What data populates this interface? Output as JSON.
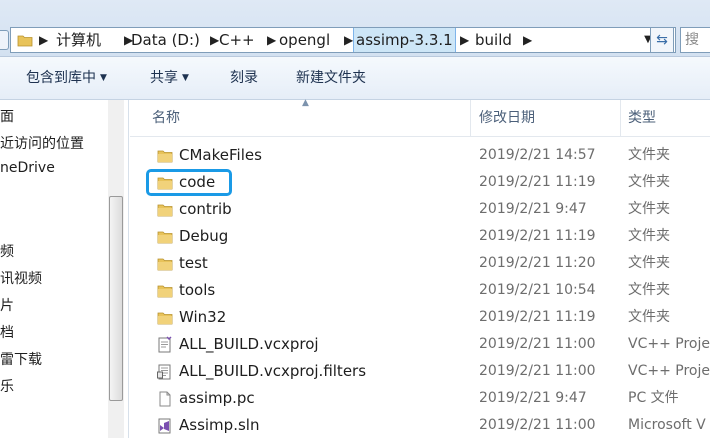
{
  "address_bar": {
    "segments": [
      "计算机",
      "Data (D:)",
      "C++",
      "opengl",
      "assimp-3.3.1",
      "build"
    ],
    "search_placeholder": "搜"
  },
  "toolbar": {
    "include_in_library": "包含到库中",
    "share": "共享",
    "burn": "刻录",
    "new_folder": "新建文件夹"
  },
  "nav_pane": {
    "items": [
      "面",
      "近访问的位置",
      "neDrive",
      "频",
      "讯视频",
      "片",
      "档",
      "雷下载",
      "乐"
    ]
  },
  "columns": {
    "name": "名称",
    "date": "修改日期",
    "type": "类型"
  },
  "files": [
    {
      "icon": "folder-icon",
      "name": "CMakeFiles",
      "date": "2019/2/21 14:57",
      "type": "文件夹"
    },
    {
      "icon": "folder-icon",
      "name": "code",
      "date": "2019/2/21 11:19",
      "type": "文件夹"
    },
    {
      "icon": "folder-icon",
      "name": "contrib",
      "date": "2019/2/21 9:47",
      "type": "文件夹"
    },
    {
      "icon": "folder-icon",
      "name": "Debug",
      "date": "2019/2/21 11:19",
      "type": "文件夹"
    },
    {
      "icon": "folder-icon",
      "name": "test",
      "date": "2019/2/21 11:20",
      "type": "文件夹"
    },
    {
      "icon": "folder-icon",
      "name": "tools",
      "date": "2019/2/21 10:54",
      "type": "文件夹"
    },
    {
      "icon": "folder-icon",
      "name": "Win32",
      "date": "2019/2/21 11:19",
      "type": "文件夹"
    },
    {
      "icon": "vcxproj-icon",
      "name": "ALL_BUILD.vcxproj",
      "date": "2019/2/21 11:00",
      "type": "VC++ Proje"
    },
    {
      "icon": "filters-icon",
      "name": "ALL_BUILD.vcxproj.filters",
      "date": "2019/2/21 11:00",
      "type": "VC++ Proje"
    },
    {
      "icon": "file-icon",
      "name": "assimp.pc",
      "date": "2019/2/21 9:47",
      "type": "PC 文件"
    },
    {
      "icon": "sln-icon",
      "name": "Assimp.sln",
      "date": "2019/2/21 11:00",
      "type": "Microsoft V"
    }
  ],
  "highlighted_item": "code",
  "colors": {
    "highlight": "#1a9ae6",
    "folder": "#e8c35a",
    "header_text": "#4c607a"
  }
}
